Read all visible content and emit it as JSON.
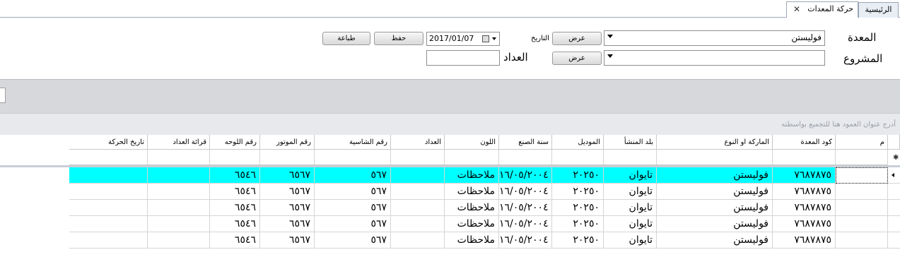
{
  "tabs": {
    "home": "الرئيسية",
    "active": "حركة المعدات",
    "close_glyph": "✕"
  },
  "form": {
    "equipment_label": "المعدة",
    "equipment_value": "فوليستن",
    "project_label": "المشروع",
    "project_value": "",
    "show_button": "عرض",
    "show_button_2": "عرض",
    "date_label": "التاريخ",
    "date_value": "2017/01/07",
    "counter_label": "العداد",
    "counter_value": "",
    "save_button": "حفظ",
    "print_button": "طباعة"
  },
  "grid": {
    "group_hint": "أدرج عنوان العمود هنا للتجميع بواسطته",
    "new_row_glyph": "✱",
    "columns": [
      "م",
      "كود المعدة",
      "الماركة او النوع",
      "بلد المنشأ",
      "الموديل",
      "سنة الصنع",
      "اللون",
      "العداد",
      "رقم الشاسية",
      "رقم الموتور",
      "رقم اللوحه",
      "قرائة العداد",
      "تاريخ الحركة"
    ],
    "rows": [
      [
        "",
        "٧٦٨٧٨٧٥",
        "فوليستن",
        "تايوان",
        "٢٠٢٥٠",
        "١٦/٠٥/٢٠٠٤",
        "ملاحظات",
        "",
        "٥٦٧",
        "٦٥٦٧",
        "٦٥٤٦",
        "",
        ""
      ],
      [
        "",
        "٧٦٨٧٨٧٥",
        "فوليستن",
        "تايوان",
        "٢٠٢٥٠",
        "١٦/٠٥/٢٠٠٤",
        "ملاحظات",
        "",
        "٥٦٧",
        "٦٥٦٧",
        "٦٥٤٦",
        "",
        ""
      ],
      [
        "",
        "٧٦٨٧٨٧٥",
        "فوليستن",
        "تايوان",
        "٢٠٢٥٠",
        "١٦/٠٥/٢٠٠٤",
        "ملاحظات",
        "",
        "٥٦٧",
        "٦٥٦٧",
        "٦٥٤٦",
        "",
        ""
      ],
      [
        "",
        "٧٦٨٧٨٧٥",
        "فوليستن",
        "تايوان",
        "٢٠٢٥٠",
        "١٦/٠٥/٢٠٠٤",
        "ملاحظات",
        "",
        "٥٦٧",
        "٦٥٦٧",
        "٦٥٤٦",
        "",
        ""
      ],
      [
        "",
        "٧٦٨٧٨٧٥",
        "فوليستن",
        "تايوان",
        "٢٠٢٥٠",
        "١٦/٠٥/٢٠٠٤",
        "ملاحظات",
        "",
        "٥٦٧",
        "٦٥٦٧",
        "٦٥٤٦",
        "",
        ""
      ]
    ],
    "selected_row_color": "#00ffff"
  }
}
